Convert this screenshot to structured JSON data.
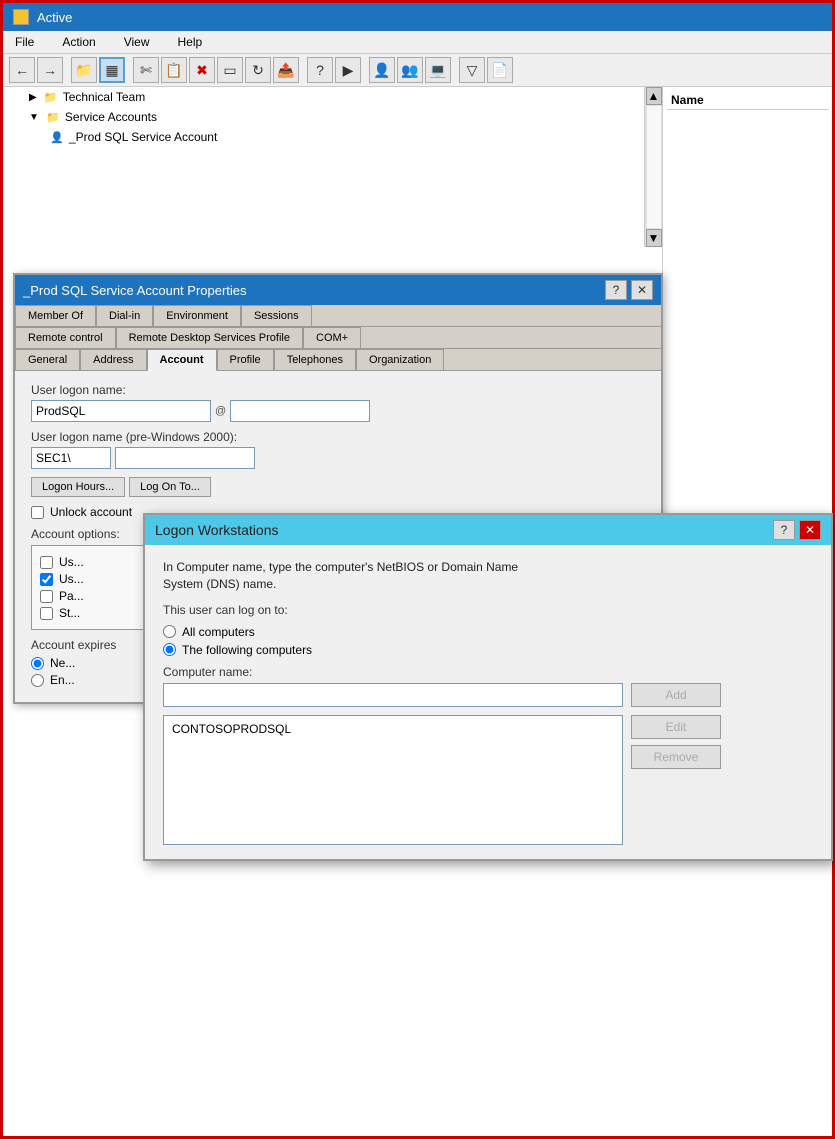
{
  "window": {
    "title": "Active",
    "icon": "folder-icon"
  },
  "menu": {
    "items": [
      "File",
      "Action",
      "View",
      "Help"
    ]
  },
  "toolbar": {
    "buttons": [
      "←",
      "→",
      "📁",
      "▦",
      "✂",
      "📋",
      "✖",
      "🗒",
      "🔄",
      "📤",
      "?",
      "▶",
      "👤",
      "👥",
      "🖥",
      "▽",
      "📄"
    ]
  },
  "tree": {
    "header": "",
    "items": [
      {
        "label": "Technical Team",
        "indent": 1,
        "type": "folder",
        "expanded": false
      },
      {
        "label": "Service Accounts",
        "indent": 1,
        "type": "folder",
        "expanded": true
      },
      {
        "label": "_Prod SQL Service Account",
        "indent": 2,
        "type": "user",
        "selected": false
      }
    ]
  },
  "right_panel": {
    "column_header": "Name"
  },
  "properties_dialog": {
    "title": "_Prod SQL Service Account Properties",
    "tabs": {
      "row1": [
        "Member Of",
        "Dial-in",
        "Environment",
        "Sessions"
      ],
      "row2": [
        "Remote control",
        "Remote Desktop Services Profile",
        "COM+"
      ],
      "row3": [
        "General",
        "Address",
        "Account",
        "Profile",
        "Telephones",
        "Organization"
      ]
    },
    "active_tab": "Account",
    "fields": {
      "user_logon_label": "User logon name:",
      "user_logon_value": "ProdSQL",
      "user_logon_pre": "SEC1\\",
      "user_logon_pre_label": "User logon name (pre-Windows 2000):",
      "logon_hours_btn": "Logon Hours...",
      "logon_to_btn": "Log On To...",
      "unlock_label": "Unlock account",
      "account_options_label": "Account options:",
      "checkboxes": [
        {
          "label": "Us",
          "checked": false
        },
        {
          "label": "Us",
          "checked": true
        },
        {
          "label": "Pa",
          "checked": false
        },
        {
          "label": "St",
          "checked": false
        }
      ],
      "account_expires_label": "Account expires",
      "radios": [
        {
          "label": "Ne",
          "checked": true
        },
        {
          "label": "En",
          "checked": false
        }
      ]
    }
  },
  "logon_dialog": {
    "title": "Logon Workstations",
    "description_line1": "In Computer name, type the computer's NetBIOS or Domain Name",
    "description_line2": "System (DNS) name.",
    "log_on_to_label": "This user can log on to:",
    "radio_all": "All computers",
    "radio_following": "The following computers",
    "computer_name_label": "Computer name:",
    "computer_name_value": "",
    "computers_list": [
      "CONTOSOPRODSQL"
    ],
    "btn_add": "Add",
    "btn_edit": "Edit",
    "btn_remove": "Remove",
    "btn_help": "?",
    "btn_close": "✕"
  }
}
